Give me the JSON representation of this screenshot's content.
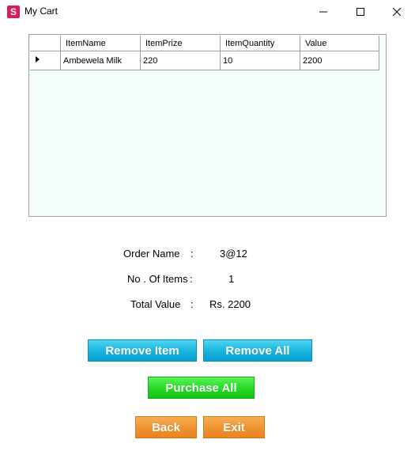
{
  "window": {
    "title": "My Cart",
    "icon_letter": "S",
    "controls": {
      "minimize": "minimize-icon",
      "maximize": "maximize-icon",
      "close": "close-icon"
    }
  },
  "cart_table": {
    "columns": [
      "ItemName",
      "ItemPrize",
      "ItemQuantity",
      "Value"
    ],
    "rows": [
      [
        "Ambewela Milk",
        "220",
        "10",
        "2200"
      ]
    ],
    "grid_background": "#f2fdf8"
  },
  "summary": {
    "order_name_label": "Order Name",
    "order_name_colon": ":",
    "order_name_value": "3@12",
    "items_label": "No . Of Items",
    "items_colon": ":",
    "items_value": "1",
    "total_label": "Total Value",
    "total_colon": ":",
    "total_value": "Rs. 2200"
  },
  "buttons": {
    "remove_item": "Remove Item",
    "remove_all": "Remove All",
    "purchase_all": "Purchase All",
    "back": "Back",
    "exit": "Exit"
  },
  "colors": {
    "blue_button": "#16b2dc",
    "green_button": "#24d824",
    "orange_button": "#ef9130",
    "app_icon": "#d9195c"
  }
}
